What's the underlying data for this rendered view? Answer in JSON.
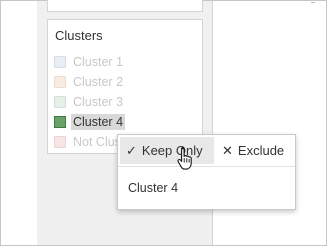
{
  "legend": {
    "title": "Clusters",
    "items": [
      {
        "label": "Cluster 1",
        "color": "#e8eef3",
        "border": "#d5dee7",
        "selected": false
      },
      {
        "label": "Cluster 2",
        "color": "#f8ece2",
        "border": "#eedccd",
        "selected": false
      },
      {
        "label": "Cluster 3",
        "color": "#e6efe8",
        "border": "#d3e1d6",
        "selected": false
      },
      {
        "label": "Cluster 4",
        "color": "#6aa26c",
        "border": "#3f7a43",
        "selected": true
      },
      {
        "label": "Not Clus",
        "color": "#f7e6e6",
        "border": "#ecd3d3",
        "selected": false
      }
    ]
  },
  "popup": {
    "keep_icon": "✓",
    "keep_label": "Keep Only",
    "exclude_icon": "✕",
    "exclude_label": "Exclude",
    "value": "Cluster 4"
  }
}
